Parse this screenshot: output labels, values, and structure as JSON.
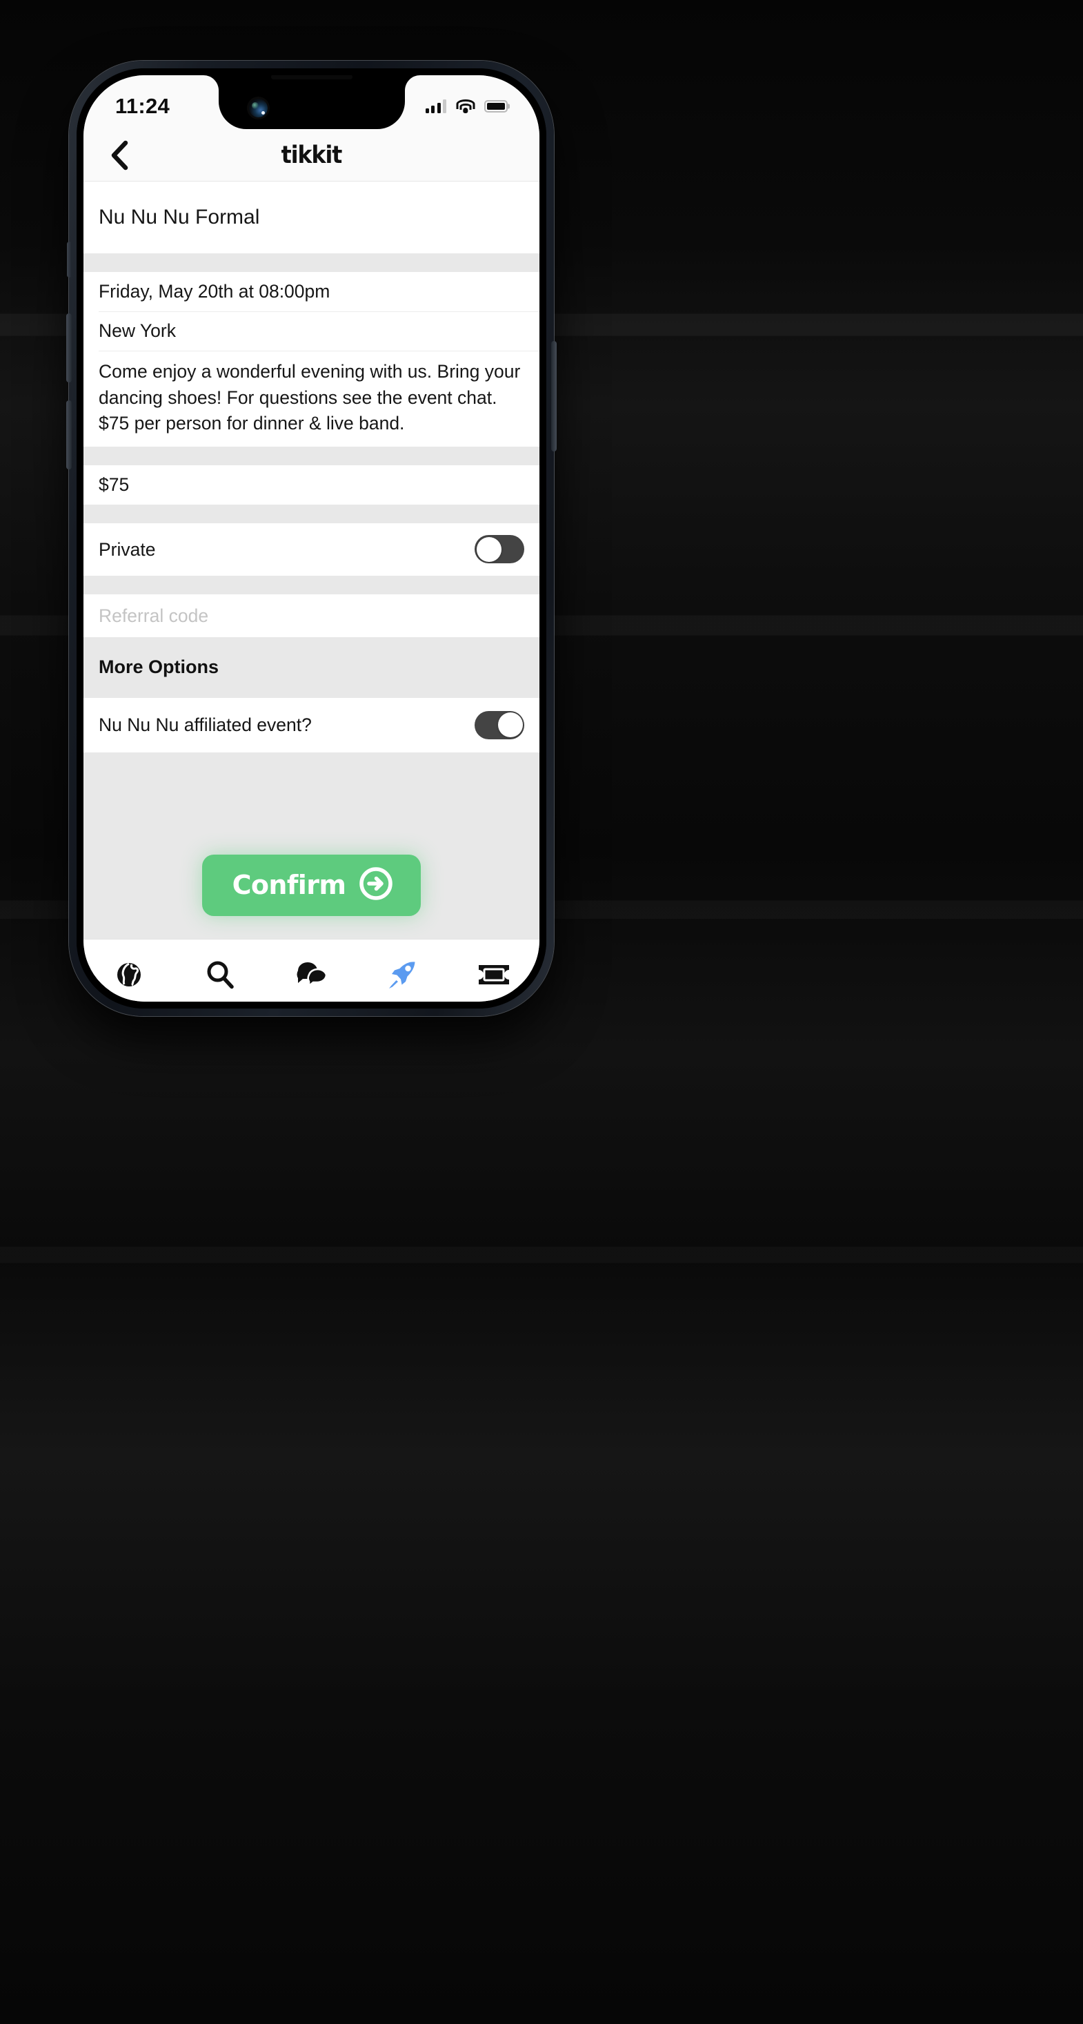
{
  "status_bar": {
    "time": "11:24",
    "signal_icon": "cellular-signal-icon",
    "wifi_icon": "wifi-icon",
    "battery_icon": "battery-icon"
  },
  "header": {
    "back_icon": "chevron-left-icon",
    "brand": "tikkit"
  },
  "form": {
    "event_name": "Nu Nu Nu Formal",
    "datetime": "Friday, May 20th at 08:00pm",
    "location": "New York",
    "description": "Come enjoy a wonderful evening with us. Bring your dancing shoes! For questions see the event chat. $75 per person for dinner & live band.",
    "price": "$75",
    "private_label": "Private",
    "private_state": "off",
    "referral_placeholder": "Referral code",
    "referral_value": "",
    "more_options_heading": "More Options",
    "affiliated_label": "Nu Nu Nu affiliated event?",
    "affiliated_state": "on"
  },
  "confirm": {
    "label": "Confirm",
    "icon": "arrow-right-circle-icon",
    "color": "#5ECB7E"
  },
  "tabbar": {
    "active_color": "#5B9BF0",
    "inactive_color": "#111111",
    "items": [
      {
        "icon": "globe-icon",
        "name": "discover",
        "active": false
      },
      {
        "icon": "search-icon",
        "name": "search",
        "active": false
      },
      {
        "icon": "chat-icon",
        "name": "chat",
        "active": false
      },
      {
        "icon": "rocket-icon",
        "name": "create",
        "active": true
      },
      {
        "icon": "ticket-icon",
        "name": "tickets",
        "active": false
      }
    ]
  }
}
